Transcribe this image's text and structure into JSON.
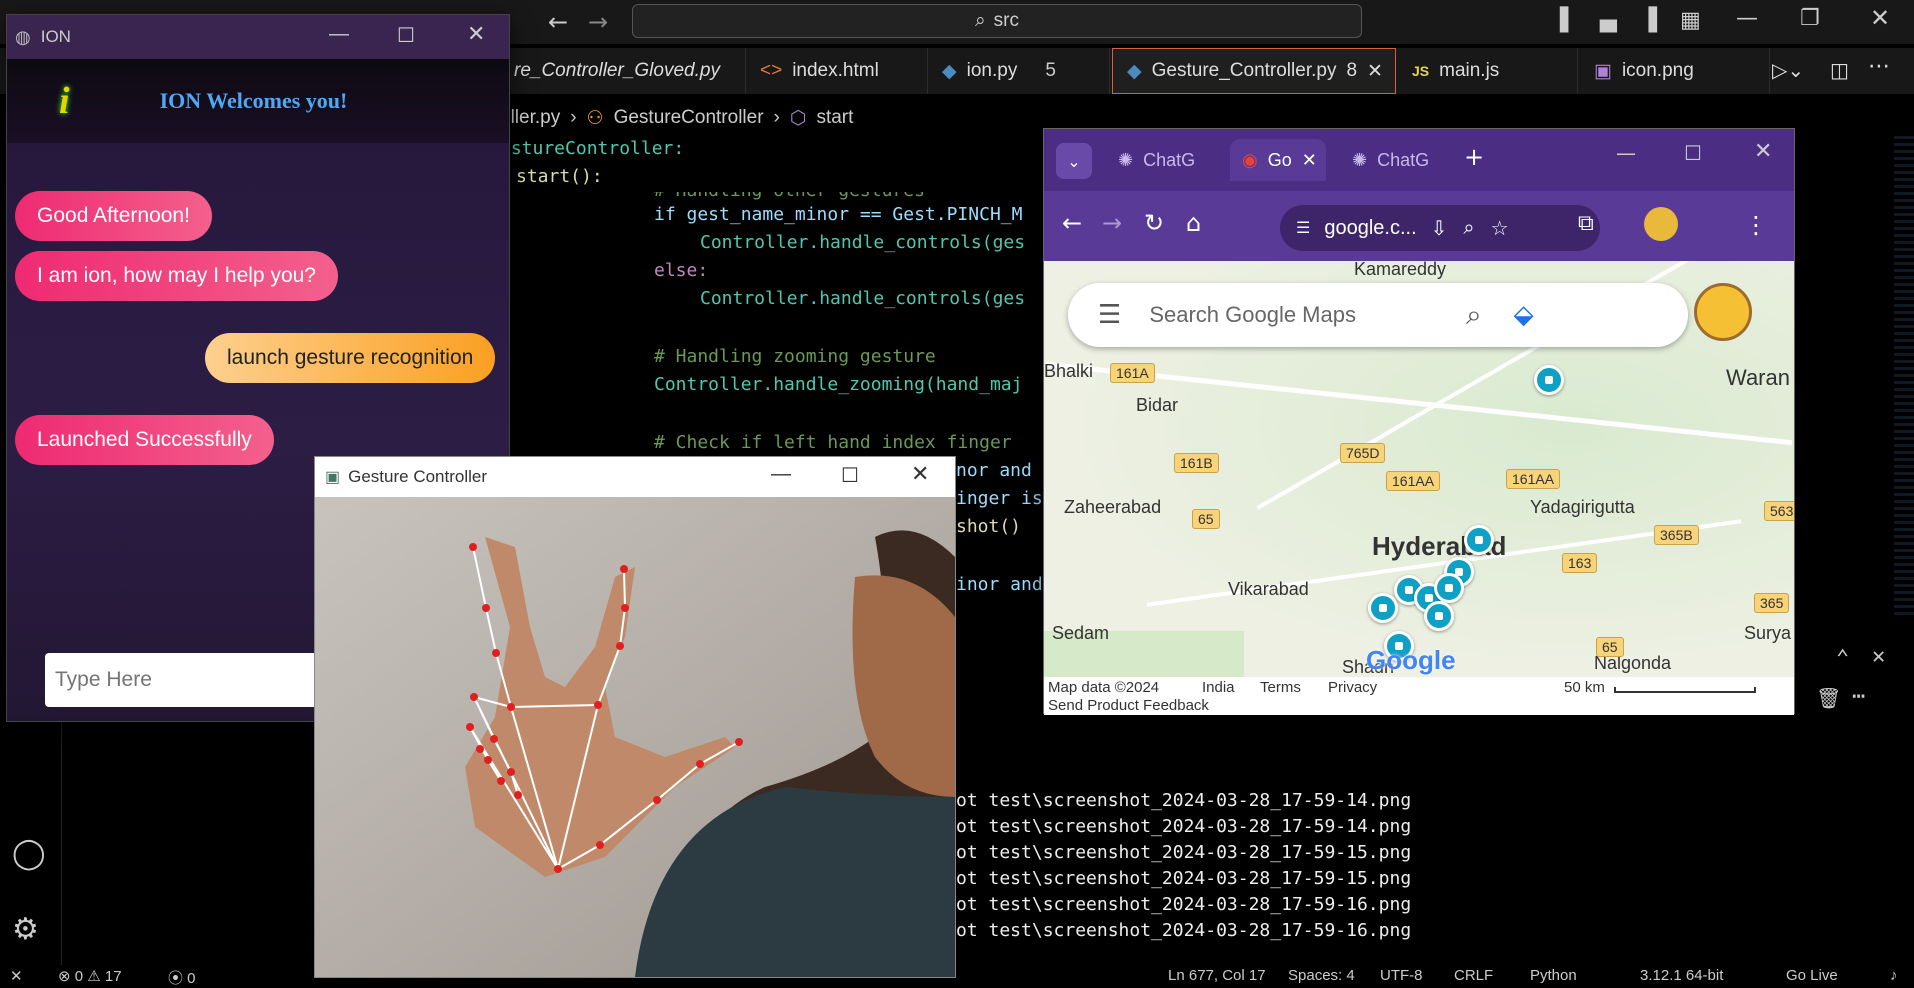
{
  "vscode": {
    "search_label": "src",
    "tabs": [
      {
        "label": "re_Controller_Gloved.py",
        "icon": "python-icon"
      },
      {
        "label": "index.html",
        "icon": "html-icon"
      },
      {
        "label": "ion.py",
        "badge": "5",
        "icon": "python-icon"
      },
      {
        "label": "Gesture_Controller.py",
        "badge": "8",
        "icon": "python-icon",
        "active": true
      },
      {
        "label": "main.js",
        "icon": "js-icon"
      },
      {
        "label": "icon.png",
        "icon": "image-icon"
      }
    ],
    "breadcrumb": [
      "oller.py",
      "GestureController",
      "start"
    ],
    "code": [
      "estureController:",
      "start():",
      "# Handling other gestures",
      "if gest_name_minor == Gest.PINCH_M",
      "Controller.handle_controls(ges",
      "else:",
      "Controller.handle_controls(ges",
      "# Handling zooming gesture",
      "Controller.handle_zooming(hand_maj",
      "# Check if left hand index finger",
      "nor and",
      "inger is",
      "shot()",
      "inor and"
    ],
    "terminal_lines": [
      "ot test\\screenshot_2024-03-28_17-59-14.png",
      "ot test\\screenshot_2024-03-28_17-59-14.png",
      "ot test\\screenshot_2024-03-28_17-59-15.png",
      "ot test\\screenshot_2024-03-28_17-59-15.png",
      "ot test\\screenshot_2024-03-28_17-59-16.png",
      "ot test\\screenshot_2024-03-28_17-59-16.png"
    ],
    "status": {
      "errors": "0",
      "warnings": "17",
      "ports": "0",
      "position": "Ln 677, Col 17",
      "spaces": "Spaces: 4",
      "encoding": "UTF-8",
      "eol": "CRLF",
      "language": "Python",
      "version": "3.12.1 64-bit",
      "golive": "Go Live"
    }
  },
  "ion": {
    "title": "ION",
    "welcome": "ION Welcomes you!",
    "messages": [
      {
        "text": "Good Afternoon!",
        "side": "left"
      },
      {
        "text": "I am ion, how may I help you?",
        "side": "left"
      },
      {
        "text": "launch gesture recognition",
        "side": "right"
      },
      {
        "text": "Launched Successfully",
        "side": "left"
      }
    ],
    "input_placeholder": "Type Here"
  },
  "gesture": {
    "title": "Gesture Controller"
  },
  "chrome": {
    "tabs": [
      "ChatG",
      "Go",
      "ChatG"
    ],
    "address": "google.c...",
    "search_placeholder": "Search Google Maps",
    "places": [
      "Kamareddy",
      "Bhalki",
      "Bidar",
      "Zaheerabad",
      "Vikarabad",
      "Sedam",
      "Hyderabad",
      "Yadagirigutta",
      "Waran",
      "Surya",
      "Nalgonda",
      "Shadn"
    ],
    "shields": [
      "161A",
      "161B",
      "765D",
      "161AA",
      "161AA",
      "65",
      "163",
      "365B",
      "563",
      "365",
      "65"
    ],
    "footer": {
      "map_data": "Map data ©2024",
      "country": "India",
      "terms": "Terms",
      "privacy": "Privacy",
      "scale": "50 km",
      "feedback": "Send Product Feedback"
    },
    "logo": "Google"
  }
}
